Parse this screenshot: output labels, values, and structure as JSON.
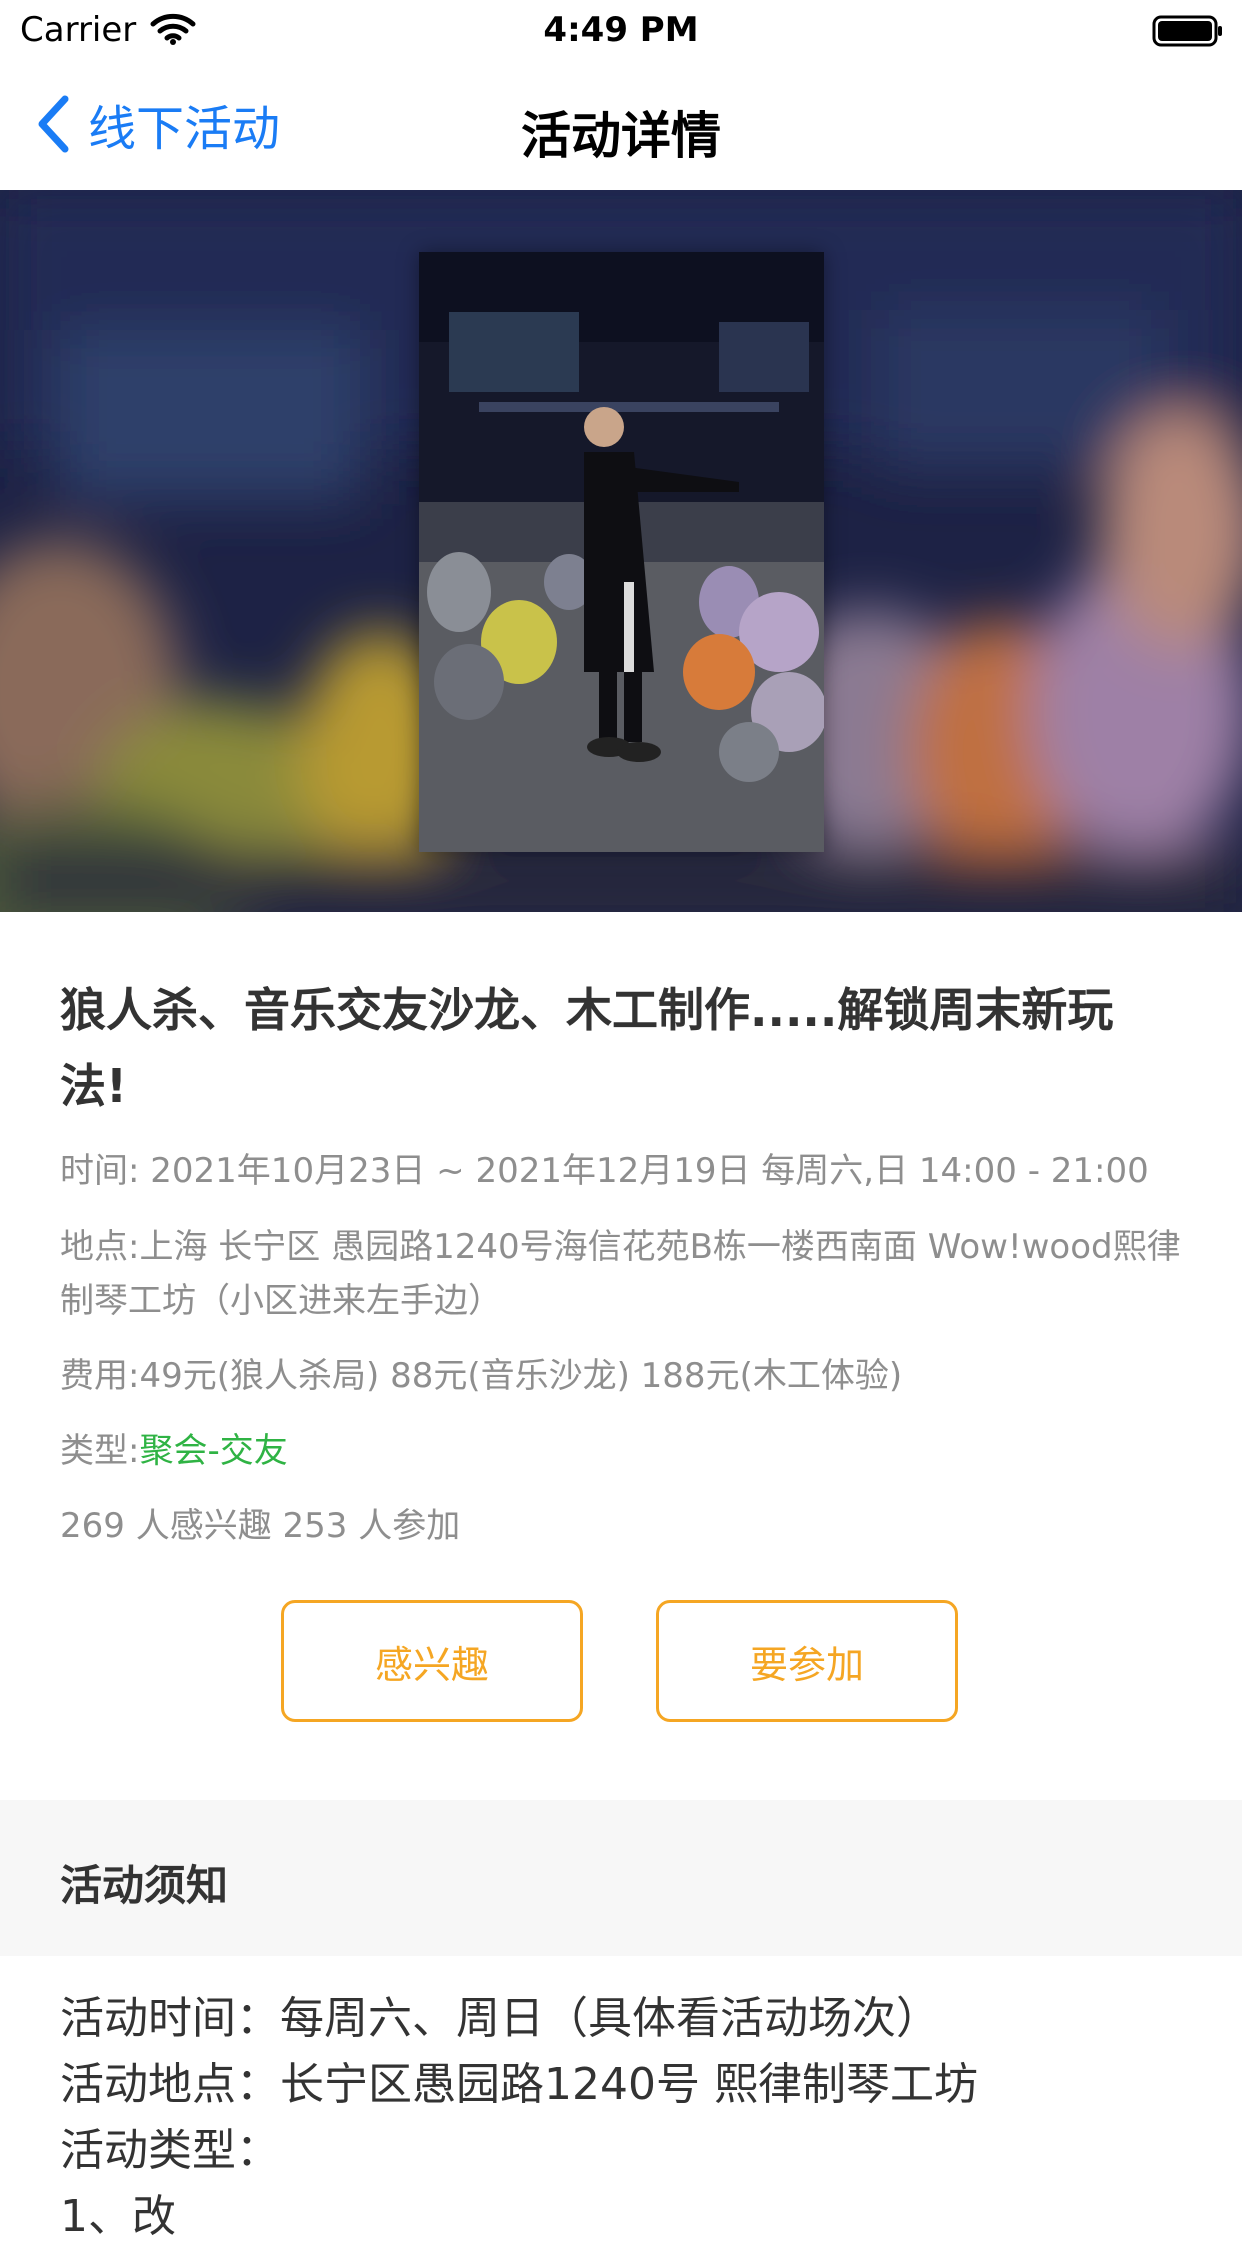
{
  "status_bar": {
    "carrier": "Carrier",
    "time": "4:49 PM"
  },
  "nav": {
    "back_label": "线下活动",
    "title": "活动详情"
  },
  "event": {
    "title": "狼人杀、音乐交友沙龙、木工制作.....解锁周末新玩法!",
    "time_label": "时间:",
    "time_value": "2021年10月23日 ~ 2021年12月19日 每周六,日 14:00 - 21:00",
    "location_label": "地点:",
    "location_value": "上海  长宁区  愚园路1240号海信花苑B栋一楼西南面 Wow!wood熙律制琴工坊（小区进来左手边）",
    "fee_label": "费用:",
    "fee_value": "49元(狼人杀局)   88元(音乐沙龙)   188元(木工体验)",
    "type_label": "类型:",
    "type_value": "聚会-交友",
    "stats": "269 人感兴趣   253 人参加"
  },
  "buttons": {
    "interested": "感兴趣",
    "join": "要参加"
  },
  "notice": {
    "heading": "活动须知",
    "lines": [
      "活动时间：每周六、周日（具体看活动场次）",
      "活动地点：长宁区愚园路1240号 熙律制琴工坊",
      "活动类型：",
      "1、改"
    ]
  },
  "colors": {
    "accent_blue": "#1a7cf5",
    "button_orange": "#f5a623",
    "type_green": "#2fb344"
  }
}
